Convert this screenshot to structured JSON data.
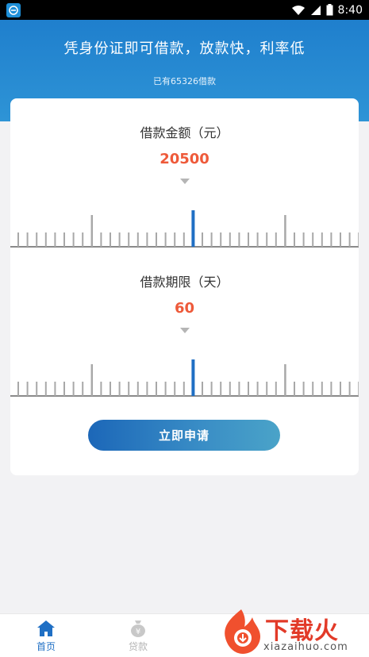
{
  "status_bar": {
    "time": "8:40"
  },
  "header": {
    "title": "凭身份证即可借款，放款快，利率低",
    "subtitle": "已有65326借款"
  },
  "amount": {
    "label": "借款金额（元）",
    "value": "20500"
  },
  "term": {
    "label": "借款期限（天）",
    "value": "60"
  },
  "apply_button": {
    "label": "立即申请"
  },
  "nav": {
    "items": [
      {
        "label": "首页",
        "icon": "home-icon",
        "active": true
      },
      {
        "label": "贷款",
        "icon": "money-bag-icon",
        "active": false
      }
    ]
  },
  "watermark": {
    "text": "下载火",
    "url": "xiazaihuo.com"
  },
  "colors": {
    "primary": "#1f7fcd",
    "accent_value": "#ee5a3a",
    "ruler_marker": "#1f6fc4",
    "ruler_tick": "#a8a8a8"
  }
}
